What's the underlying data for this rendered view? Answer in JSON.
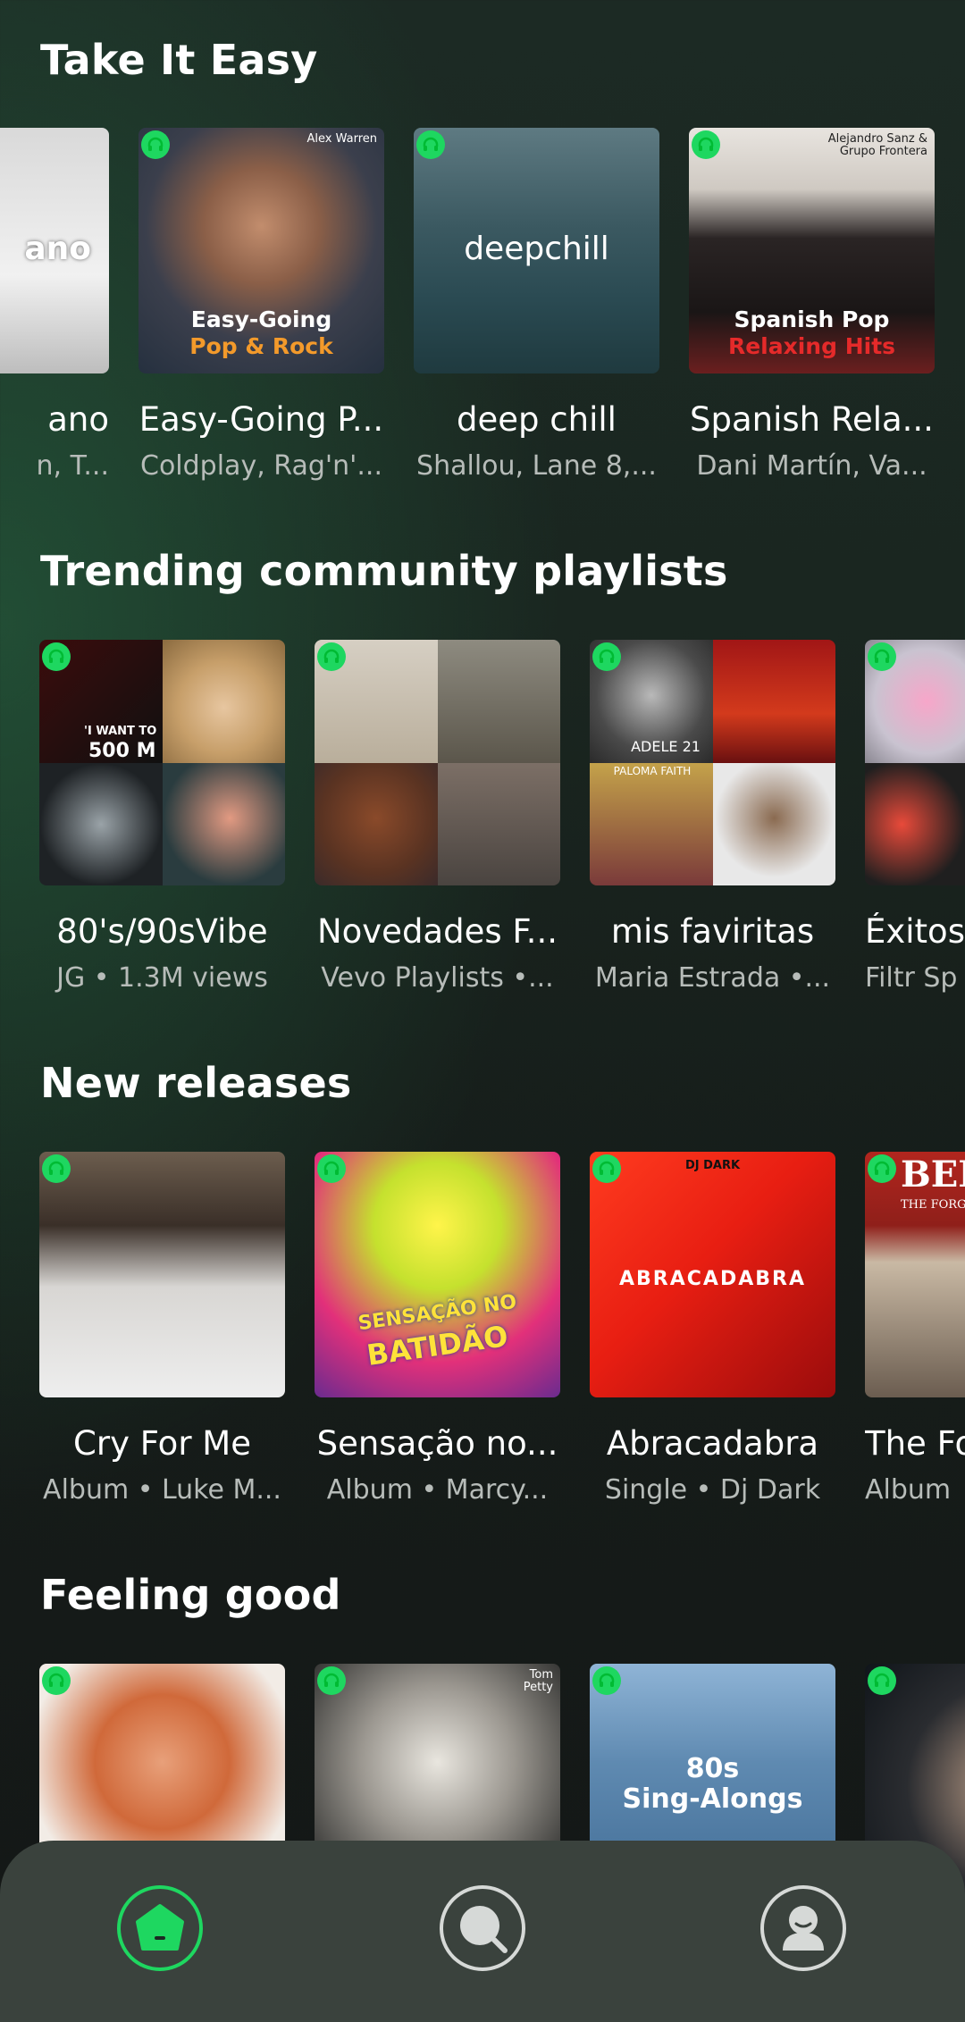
{
  "sections": [
    {
      "title": "Take It Easy",
      "cards": [
        {
          "title": "ano",
          "subtitle": "n, T...",
          "overlay": "ano"
        },
        {
          "title": "Easy-Going P...",
          "subtitle": "Coldplay, Rag'n'...",
          "artist_tag": "Alex Warren",
          "overlay_line1": "Easy-Going",
          "overlay_line2": "Pop & Rock"
        },
        {
          "title": "deep chill",
          "subtitle": "Shallou, Lane 8,...",
          "overlay": "deepchill"
        },
        {
          "title": "Spanish Rela...",
          "subtitle": "Dani Martín, Va...",
          "artist_tag_line1": "Alejandro Sanz &",
          "artist_tag_line2": "Grupo Frontera",
          "overlay_line1": "Spanish Pop",
          "overlay_line2": "Relaxing Hits"
        }
      ]
    },
    {
      "title": "Trending community playlists",
      "cards": [
        {
          "title": "80's/90sVibe",
          "subtitle": "JG • 1.3M views",
          "overlay_line1": "'I WANT TO",
          "overlay_line2": "500 M"
        },
        {
          "title": "Novedades F...",
          "subtitle": "Vevo Playlists •..."
        },
        {
          "title": "mis faviritas",
          "subtitle": "Maria Estrada •...",
          "overlay_line1": "ADELE 21",
          "overlay_line2": "PALOMA FAITH"
        },
        {
          "title": "Éxitos",
          "subtitle": "Filtr Sp"
        }
      ]
    },
    {
      "title": "New releases",
      "cards": [
        {
          "title": "Cry For Me",
          "subtitle": "Album • Luke M..."
        },
        {
          "title": "Sensação no...",
          "subtitle": "Album • Marcy...",
          "overlay_line1": "SENSAÇÃO NO",
          "overlay_line2": "BATIDÃO"
        },
        {
          "title": "Abracadabra",
          "subtitle": "Single • Dj Dark",
          "artist_tag": "DJ DARK",
          "overlay": "ABRACADABRA"
        },
        {
          "title": "The Fo",
          "subtitle": "Album",
          "overlay_line1": "BEE",
          "overlay_line2": "THE FORGOTT"
        }
      ]
    },
    {
      "title": "Feeling good",
      "cards": [
        {
          "title": "",
          "subtitle": ""
        },
        {
          "title": "",
          "subtitle": "",
          "artist_tag_line1": "Tom",
          "artist_tag_line2": "Petty"
        },
        {
          "title": "",
          "subtitle": "",
          "overlay_line1": "80s",
          "overlay_line2": "Sing-Alongs"
        },
        {
          "title": "",
          "subtitle": ""
        }
      ]
    }
  ],
  "nav": {
    "items": [
      {
        "name": "home-icon",
        "active": true
      },
      {
        "name": "search-icon",
        "active": false
      },
      {
        "name": "profile-icon",
        "active": false
      }
    ]
  },
  "colors": {
    "accent": "#1ed760",
    "nav_bg": "#3a423d",
    "subtitle": "#b7bcb9"
  }
}
